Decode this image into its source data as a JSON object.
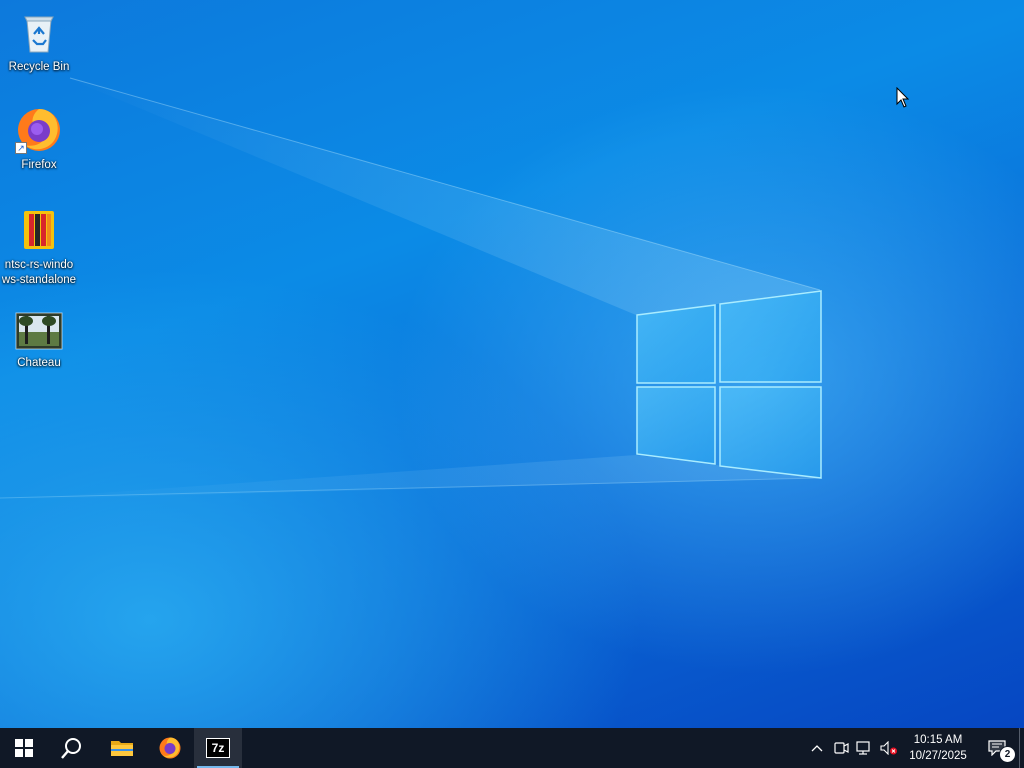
{
  "desktop": {
    "icons": [
      {
        "name": "recycle-bin",
        "label": "Recycle Bin"
      },
      {
        "name": "firefox",
        "label": "Firefox"
      },
      {
        "name": "ntsc-rs",
        "label": "ntsc-rs-windows-standalone"
      },
      {
        "name": "chateau",
        "label": "Chateau"
      }
    ]
  },
  "taskbar": {
    "start_icon": "windows-logo-icon",
    "search_icon": "search-icon",
    "pinned": [
      {
        "name": "file-explorer",
        "icon": "folder-icon"
      },
      {
        "name": "firefox",
        "icon": "firefox-icon"
      },
      {
        "name": "7zip",
        "icon": "7zip-icon",
        "icon_text": "7z",
        "active": true
      }
    ]
  },
  "tray": {
    "icons": [
      "chevron-up-icon",
      "meet-now-icon",
      "network-icon",
      "volume-muted-icon"
    ],
    "time": "10:15 AM",
    "date": "10/27/2025",
    "notification_count": "2"
  },
  "colors": {
    "taskbar": "#101826",
    "accent": "#76b9ed",
    "wallpaper": "#0a6fd9"
  }
}
